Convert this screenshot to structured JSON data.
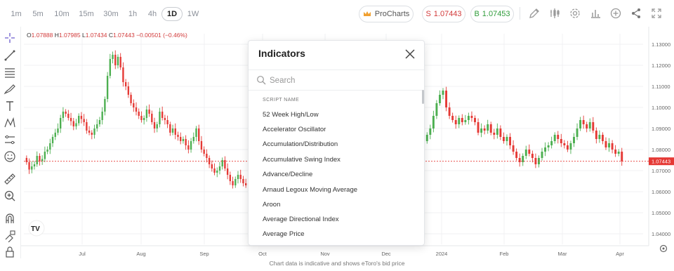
{
  "timeframes": [
    {
      "label": "1m",
      "active": false
    },
    {
      "label": "5m",
      "active": false
    },
    {
      "label": "10m",
      "active": false
    },
    {
      "label": "15m",
      "active": false
    },
    {
      "label": "30m",
      "active": false
    },
    {
      "label": "1h",
      "active": false
    },
    {
      "label": "4h",
      "active": false
    },
    {
      "label": "1D",
      "active": true
    },
    {
      "label": "1W",
      "active": false
    }
  ],
  "toolbar": {
    "prochart_label": "ProCharts",
    "sell_label": "S",
    "sell_price": "1.07443",
    "buy_label": "B",
    "buy_price": "1.07453"
  },
  "ohlc": {
    "o_label": "O",
    "o": "1.07888",
    "h_label": "H",
    "h": "1.07985",
    "l_label": "L",
    "l": "1.07434",
    "c_label": "C",
    "c": "1.07443",
    "change": "−0.00501 (−0.46%)"
  },
  "price_axis": [
    "1.13000",
    "1.12000",
    "1.11000",
    "1.10000",
    "1.09000",
    "1.08000",
    "1.07000",
    "1.06000",
    "1.05000",
    "1.04000"
  ],
  "current_price_tag": "1.07443",
  "time_axis": [
    "Jul",
    "Aug",
    "Sep",
    "Oct",
    "Nov",
    "Dec",
    "2024",
    "Feb",
    "Mar",
    "Apr"
  ],
  "footer_note": "Chart data is indicative and shows eToro's bid price",
  "indicators_modal": {
    "title": "Indicators",
    "search_placeholder": "Search",
    "list_header": "SCRIPT NAME",
    "items": [
      "52 Week High/Low",
      "Accelerator Oscillator",
      "Accumulation/Distribution",
      "Accumulative Swing Index",
      "Advance/Decline",
      "Arnaud Legoux Moving Average",
      "Aroon",
      "Average Directional Index",
      "Average Price"
    ]
  },
  "colors": {
    "up": "#4caf50",
    "down": "#e53935",
    "price_line": "#e53935"
  },
  "chart_data": {
    "type": "candlestick",
    "ylim": [
      1.035,
      1.135
    ],
    "x_ticks": [
      "Jul",
      "Aug",
      "Sep",
      "Oct",
      "Nov",
      "Dec",
      "2024",
      "Feb",
      "Mar",
      "Apr"
    ],
    "y_ticks": [
      1.13,
      1.12,
      1.11,
      1.1,
      1.09,
      1.08,
      1.07,
      1.06,
      1.05,
      1.04
    ],
    "last_close": 1.07443,
    "close": [
      1.074,
      1.0705,
      1.072,
      1.073,
      1.077,
      1.0745,
      1.0755,
      1.079,
      1.08,
      1.083,
      1.086,
      1.088,
      1.09,
      1.095,
      1.098,
      1.097,
      1.095,
      1.0935,
      1.091,
      1.0925,
      1.096,
      1.0945,
      1.093,
      1.089,
      1.088,
      1.087,
      1.09,
      1.092,
      1.094,
      1.098,
      1.104,
      1.115,
      1.123,
      1.125,
      1.12,
      1.124,
      1.119,
      1.112,
      1.11,
      1.106,
      1.102,
      1.1,
      1.098,
      1.096,
      1.094,
      1.095,
      1.099,
      1.097,
      1.093,
      1.09,
      1.092,
      1.098,
      1.095,
      1.094,
      1.092,
      1.088,
      1.09,
      1.087,
      1.086,
      1.084,
      1.085,
      1.082,
      1.08,
      1.084,
      1.086,
      1.09,
      1.084,
      1.08,
      1.078,
      1.076,
      1.073,
      1.071,
      1.069,
      1.07,
      1.072,
      1.075,
      1.071,
      1.068,
      1.065,
      1.063,
      1.066,
      1.068,
      1.066,
      1.064,
      1.063
    ],
    "close_right": [
      1.087,
      1.09,
      1.096,
      1.102,
      1.106,
      1.108,
      1.1,
      1.096,
      1.094,
      1.092,
      1.095,
      1.093,
      1.094,
      1.096,
      1.095,
      1.093,
      1.088,
      1.09,
      1.089,
      1.092,
      1.088,
      1.087,
      1.09,
      1.086,
      1.084,
      1.086,
      1.082,
      1.079,
      1.076,
      1.074,
      1.077,
      1.08,
      1.078,
      1.076,
      1.073,
      1.076,
      1.079,
      1.081,
      1.082,
      1.084,
      1.087,
      1.085,
      1.083,
      1.082,
      1.08,
      1.083,
      1.086,
      1.09,
      1.094,
      1.092,
      1.09,
      1.093,
      1.089,
      1.085,
      1.087,
      1.084,
      1.081,
      1.083,
      1.08,
      1.078,
      1.079,
      1.0744
    ]
  }
}
